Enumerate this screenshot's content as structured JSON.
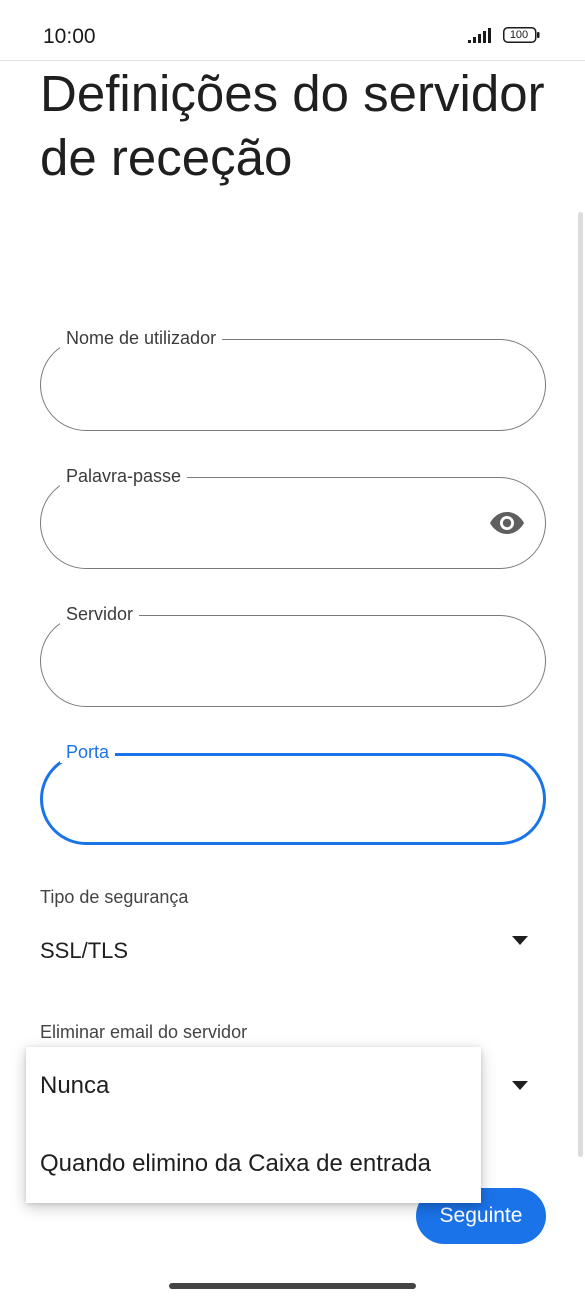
{
  "status_bar": {
    "time": "10:00",
    "battery": "100"
  },
  "page": {
    "title": "Definições do servidor de receção"
  },
  "fields": {
    "username": {
      "label": "Nome de utilizador",
      "value": ""
    },
    "password": {
      "label": "Palavra-passe",
      "value": ""
    },
    "server": {
      "label": "Servidor",
      "value": ""
    },
    "port": {
      "label": "Porta",
      "value": ""
    }
  },
  "security": {
    "label": "Tipo de segurança",
    "selected": "SSL/TLS"
  },
  "delete_email": {
    "label": "Eliminar email do servidor",
    "options": [
      "Nunca",
      "Quando elimino da Caixa de entrada"
    ]
  },
  "actions": {
    "next_label": "Seguinte"
  },
  "colors": {
    "accent": "#1a73e8",
    "outline": "#7a7a7a"
  },
  "icons": {
    "password_toggle": "eye-icon",
    "dropdown": "dropdown-arrow-icon"
  }
}
